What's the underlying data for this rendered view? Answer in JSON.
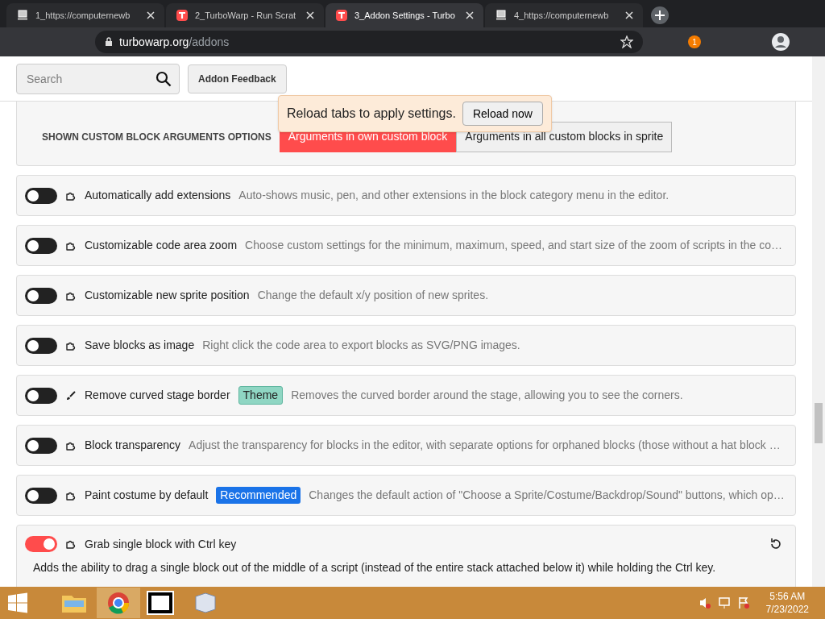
{
  "tabs": [
    {
      "title": "1_https://computernewb",
      "kind": "computer",
      "selected": false
    },
    {
      "title": "2_TurboWarp - Run Scrat",
      "kind": "turbowarp",
      "selected": false
    },
    {
      "title": "3_Addon Settings - Turbo",
      "kind": "turbowarp",
      "selected": true
    },
    {
      "title": "4_https://computernewb",
      "kind": "computer",
      "selected": false
    }
  ],
  "address": {
    "host": "turbowarp.org",
    "path": "/addons"
  },
  "extension_badge": "1",
  "search": {
    "placeholder": "Search"
  },
  "feedback_button": "Addon Feedback",
  "toast": {
    "message": "Reload tabs to apply settings.",
    "button": "Reload now"
  },
  "setting": {
    "label": "SHOWN CUSTOM BLOCK ARGUMENTS OPTIONS",
    "options": [
      {
        "label": "Arguments in own custom block",
        "selected": true
      },
      {
        "label": "Arguments in all custom blocks in sprite",
        "selected": false
      }
    ]
  },
  "addons": [
    {
      "name": "Automatically add extensions",
      "kind": "editor",
      "enabled": false,
      "expanded": false,
      "description": "Auto-shows music, pen, and other extensions in the block category menu in the editor."
    },
    {
      "name": "Customizable code area zoom",
      "kind": "editor",
      "enabled": false,
      "expanded": false,
      "description": "Choose custom settings for the minimum, maximum, speed, and start size of the zoom of scripts in the co…"
    },
    {
      "name": "Customizable new sprite position",
      "kind": "editor",
      "enabled": false,
      "expanded": false,
      "description": "Change the default x/y position of new sprites."
    },
    {
      "name": "Save blocks as image",
      "kind": "editor",
      "enabled": false,
      "expanded": false,
      "description": "Right click the code area to export blocks as SVG/PNG images."
    },
    {
      "name": "Remove curved stage border",
      "kind": "theme",
      "enabled": false,
      "expanded": false,
      "tag": {
        "label": "Theme",
        "kind": "theme"
      },
      "description": "Removes the curved border around the stage, allowing you to see the corners."
    },
    {
      "name": "Block transparency",
      "kind": "editor",
      "enabled": false,
      "expanded": false,
      "description": "Adjust the transparency for blocks in the editor, with separate options for orphaned blocks (those without a hat block …"
    },
    {
      "name": "Paint costume by default",
      "kind": "editor",
      "enabled": false,
      "expanded": false,
      "tag": {
        "label": "Recommended",
        "kind": "recommended"
      },
      "description": "Changes the default action of \"Choose a Sprite/Costume/Backdrop/Sound\" buttons, which op…"
    },
    {
      "name": "Grab single block with Ctrl key",
      "kind": "editor",
      "enabled": true,
      "expanded": true,
      "description": "Adds the ability to drag a single block out of the middle of a script (instead of the entire stack attached below it) while holding the Ctrl key."
    }
  ],
  "clock": {
    "time": "5:56 AM",
    "date": "7/23/2022"
  }
}
